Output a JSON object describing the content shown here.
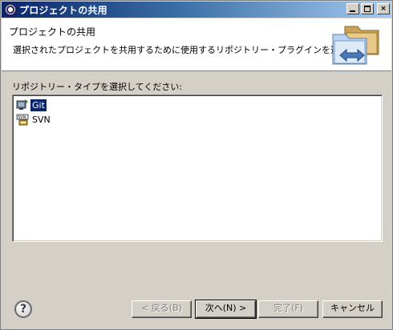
{
  "window": {
    "title": "プロジェクトの共用",
    "controls": {
      "minimize": "_",
      "maximize": "□",
      "close": "×"
    }
  },
  "header": {
    "title": "プロジェクトの共用",
    "description": "選択されたプロジェクトを共用するために使用するリポジトリー・プラグインを選択します。",
    "graphic_icon": "folder-share-icon"
  },
  "repository_list": {
    "label": "リポジトリー・タイプを選択してください:",
    "items": [
      {
        "label": "Git",
        "icon": "git-icon",
        "selected": true
      },
      {
        "label": "SVN",
        "icon": "svn-icon",
        "selected": false
      }
    ]
  },
  "buttons": {
    "help": "?",
    "back": "< 戻る(B)",
    "next": "次へ(N) >",
    "finish": "完了(F)",
    "cancel": "キャンセル"
  },
  "colors": {
    "titlebar_start": "#0a246a",
    "titlebar_end": "#a6caf0",
    "selection": "#0a246a",
    "dialog_bg": "#d4d0c8"
  }
}
